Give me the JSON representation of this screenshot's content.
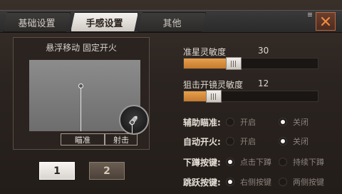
{
  "tabs": [
    {
      "label": "基础设置",
      "active": false
    },
    {
      "label": "手感设置",
      "active": true
    },
    {
      "label": "其他",
      "active": false
    }
  ],
  "close_icon": "close-x",
  "preview": {
    "title": "悬浮移动 固定开火",
    "aim_label": "瞄准",
    "fire_label": "射击",
    "fire_icon": "bullet-icon"
  },
  "presets": [
    "1",
    "2"
  ],
  "sliders": [
    {
      "label": "准星灵敏度",
      "value": "30",
      "level": 0.3
    },
    {
      "label": "狙击开镜灵敏度",
      "value": "12",
      "level": 0.12
    }
  ],
  "options": [
    {
      "label": "辅助瞄准:",
      "a": "开启",
      "b": "关闭",
      "selected": "b"
    },
    {
      "label": "自动开火:",
      "a": "开启",
      "b": "关闭",
      "selected": "b"
    },
    {
      "label": "下蹲按键:",
      "a": "点击下蹲",
      "b": "持续下蹲",
      "selected": "a"
    },
    {
      "label": "跳跃按键:",
      "a": "右侧按键",
      "b": "两侧按键",
      "selected": "a"
    }
  ],
  "colors": {
    "accent_orange": "#e6a04d",
    "close_border": "#c06a3a"
  }
}
